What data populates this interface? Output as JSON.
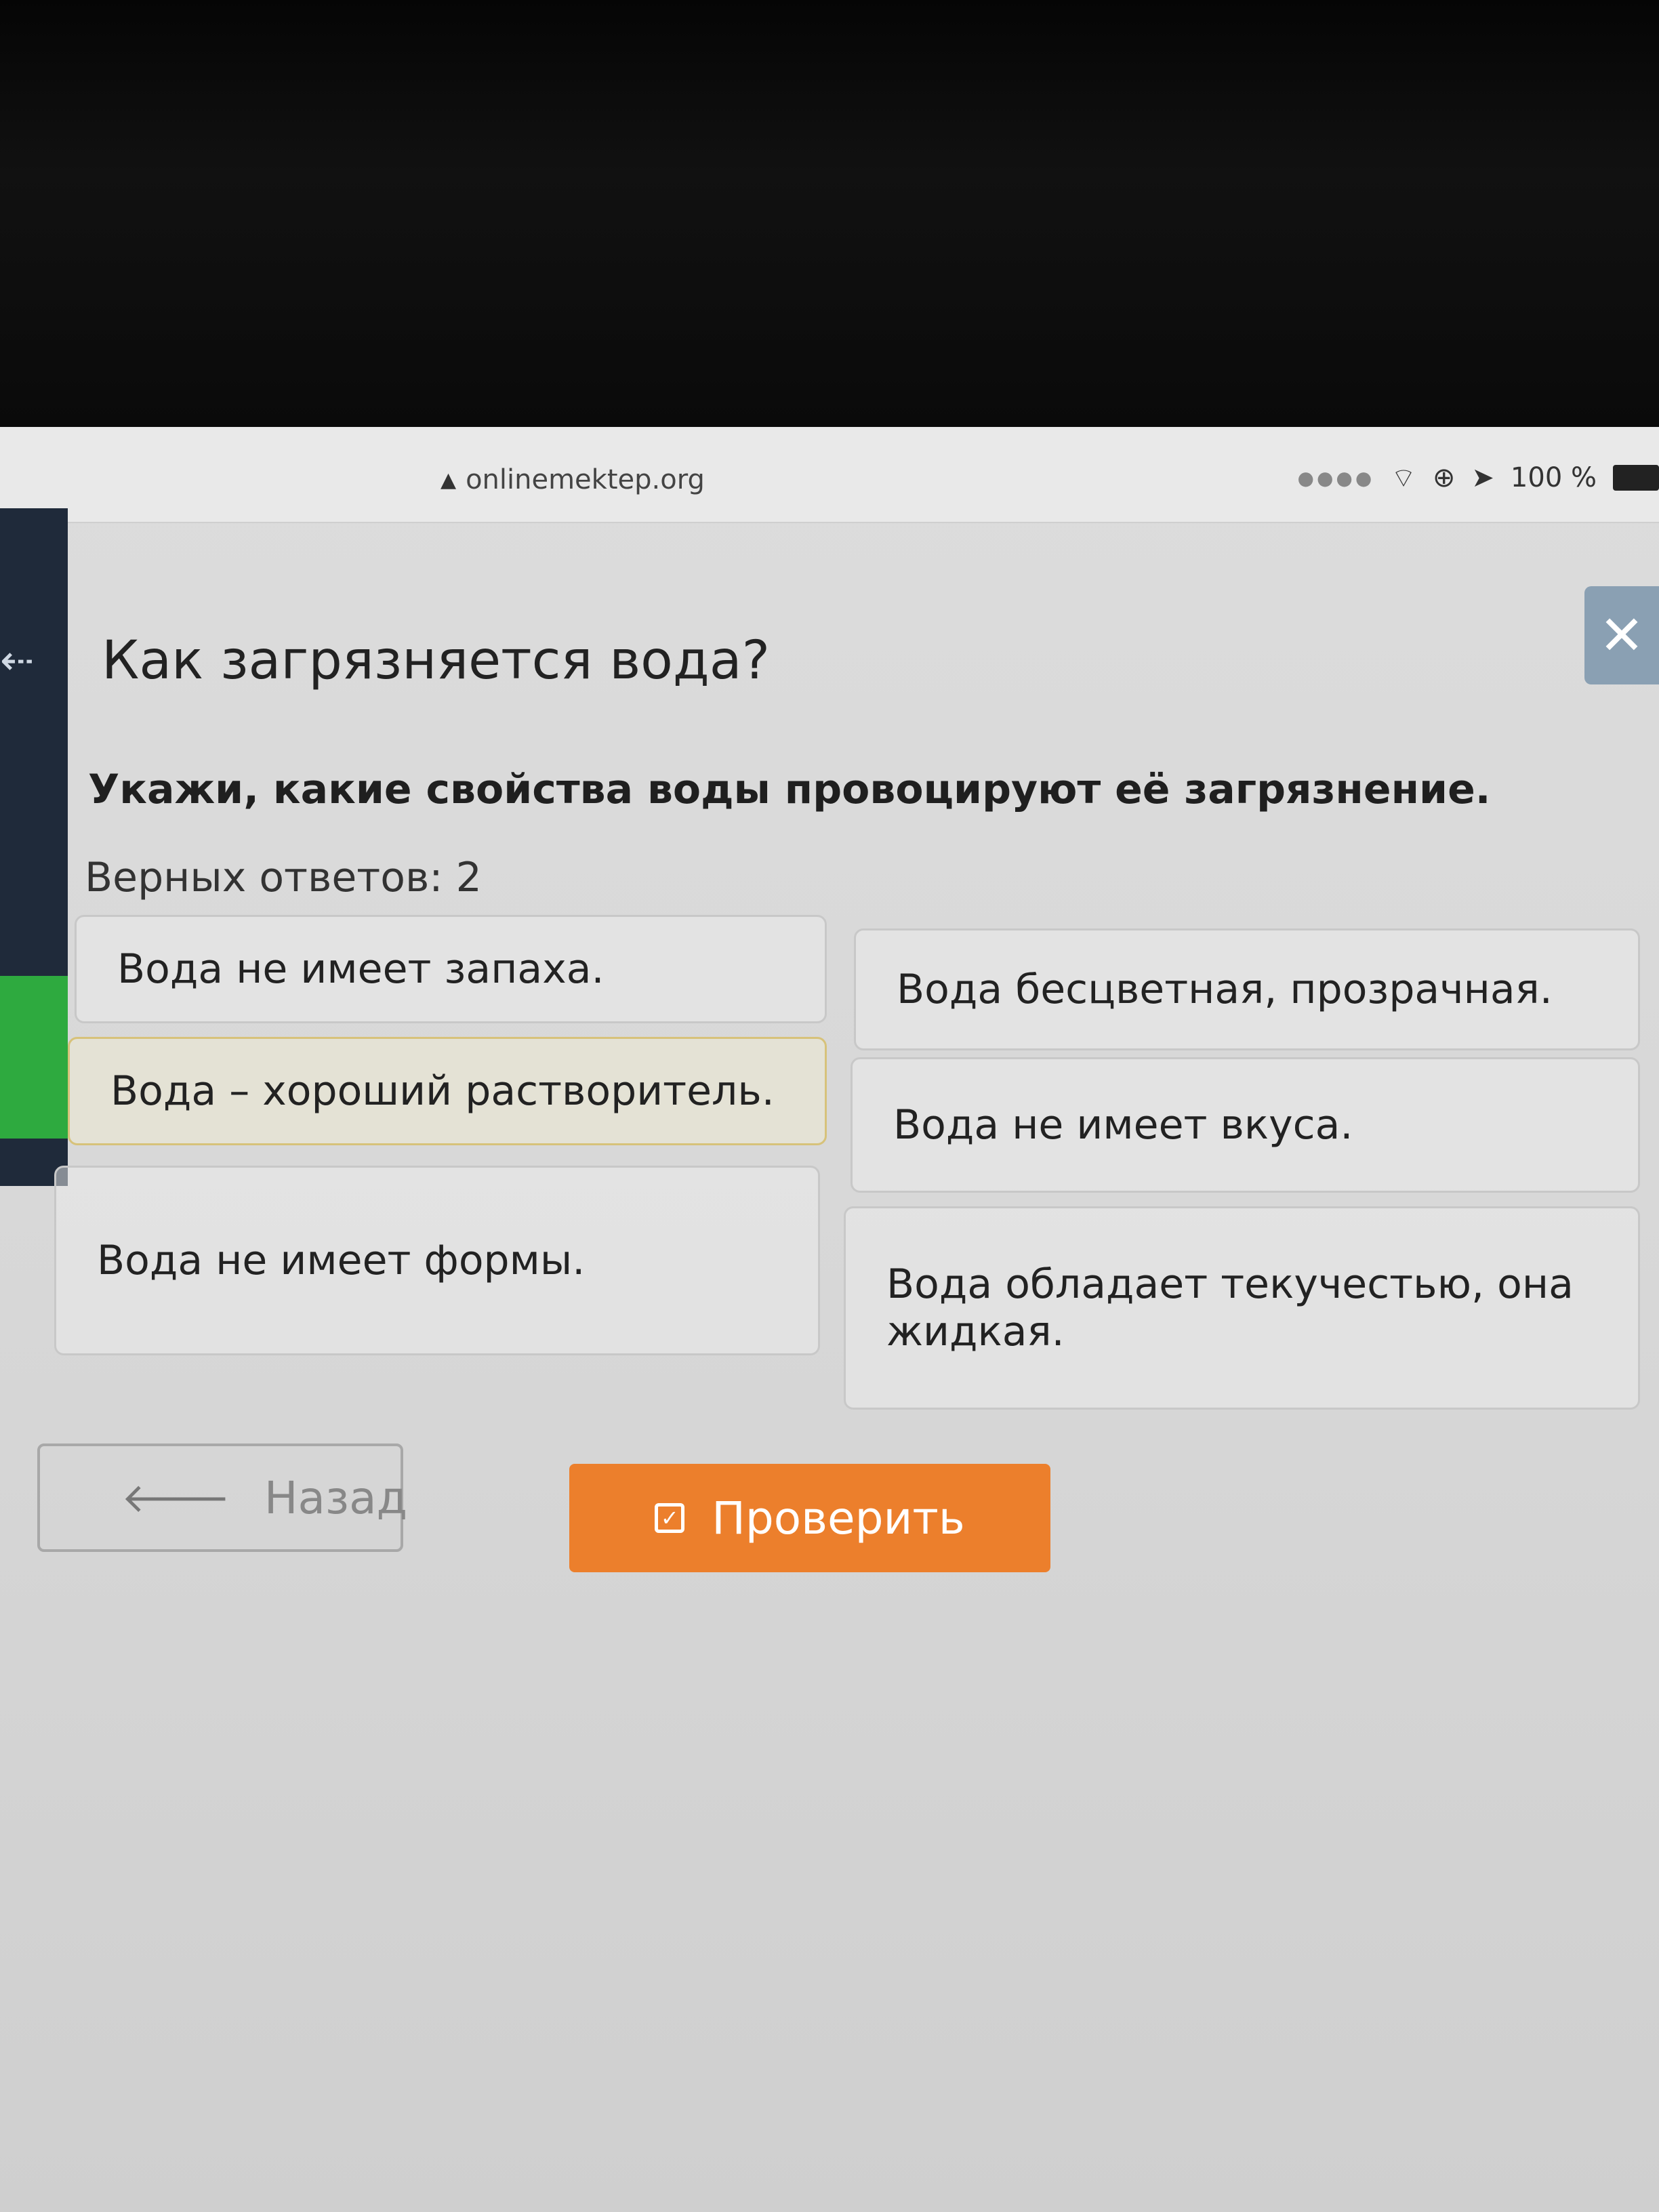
{
  "browser": {
    "url": "onlinemektep.org",
    "battery": "100 %"
  },
  "quiz": {
    "title": "Как загрязняется вода?",
    "instruction": "Укажи, какие свойства воды провоцируют её загрязнение.",
    "counter": "Верных ответов: 2",
    "options": [
      {
        "label": "Вода не имеет запаха.",
        "selected": false
      },
      {
        "label": "Вода бесцветная, прозрачная.",
        "selected": false
      },
      {
        "label": "Вода – хороший растворитель.",
        "selected": true
      },
      {
        "label": "Вода не имеет вкуса.",
        "selected": false
      },
      {
        "label": "Вода не имеет формы.",
        "selected": false
      },
      {
        "label": "Вода обладает текучестью, она жидкая.",
        "selected": false
      }
    ]
  },
  "buttons": {
    "back": "Назад",
    "check": "Проверить"
  },
  "colors": {
    "accent": "#ec7f2c",
    "selected_border": "#d7c27a",
    "sidebar": "#1f2a3a",
    "sidebar_active": "#2eaa3f"
  }
}
